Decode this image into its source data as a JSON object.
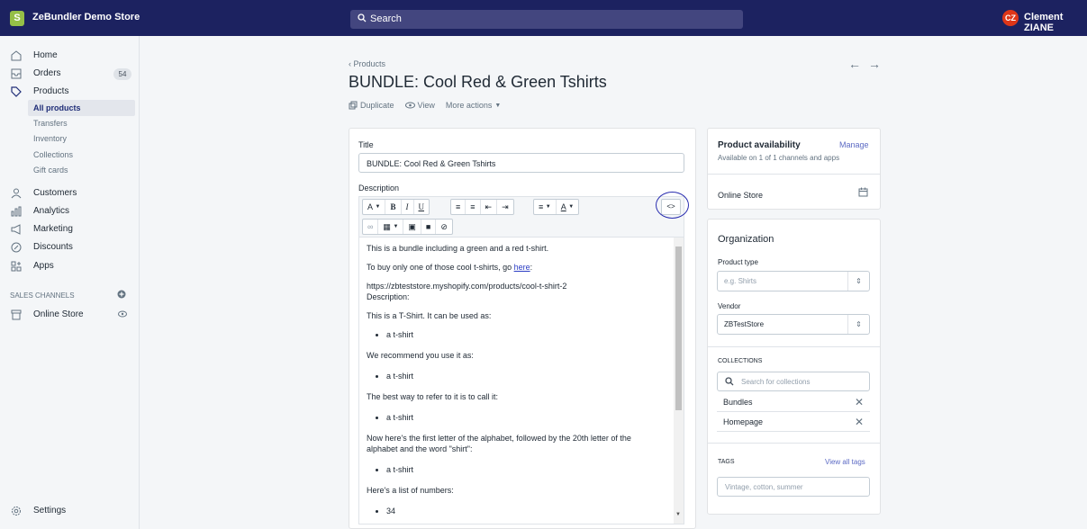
{
  "topbar": {
    "store_logo": "S",
    "store_name": "ZeBundler Demo Store",
    "search_placeholder": "Search",
    "avatar_initials": "CZ",
    "user_name": "Clement ZIANE"
  },
  "sidebar": {
    "items": [
      {
        "label": "Home"
      },
      {
        "label": "Orders",
        "badge": "54"
      },
      {
        "label": "Products"
      },
      {
        "label": "All products"
      },
      {
        "label": "Transfers"
      },
      {
        "label": "Inventory"
      },
      {
        "label": "Collections"
      },
      {
        "label": "Gift cards"
      },
      {
        "label": "Customers"
      },
      {
        "label": "Analytics"
      },
      {
        "label": "Marketing"
      },
      {
        "label": "Discounts"
      },
      {
        "label": "Apps"
      }
    ],
    "sales_channels_label": "SALES CHANNELS",
    "online_store": "Online Store",
    "settings": "Settings"
  },
  "page": {
    "back_label": "Products",
    "title": "BUNDLE: Cool Red & Green Tshirts",
    "actions": {
      "duplicate": "Duplicate",
      "view": "View",
      "more": "More actions"
    }
  },
  "form": {
    "title_label": "Title",
    "title_value": "BUNDLE: Cool Red & Green Tshirts",
    "description_label": "Description",
    "toolbar": {
      "format": "A",
      "bold": "B",
      "italic": "I",
      "underline": "U",
      "code": "<>"
    },
    "content": {
      "p1": "This is a bundle including a green and a red t-shirt.",
      "p2_pre": "To buy only one of those cool t-shirts, go ",
      "p2_link": "here",
      "p2_post": ":",
      "url": "https://zbteststore.myshopify.com/products/cool-t-shirt-2",
      "desc": "Description:",
      "p3": "This is a T-Shirt. It can be used as:",
      "li1": "a t-shirt",
      "p4": "We recommend you use it as:",
      "li2": "a t-shirt",
      "p5": "The best way to refer to it is to call it:",
      "li3": "a t-shirt",
      "p6": "Now here's the first letter of the alphabet, followed by the 20th letter of the alphabet and the word \"shirt\":",
      "li4": "a t-shirt",
      "p7": "Here's a list of numbers:",
      "li5": "34"
    }
  },
  "availability": {
    "title": "Product availability",
    "manage": "Manage",
    "subtitle": "Available on 1 of 1 channels and apps",
    "channel": "Online Store"
  },
  "organization": {
    "title": "Organization",
    "product_type_label": "Product type",
    "product_type_placeholder": "e.g. Shirts",
    "vendor_label": "Vendor",
    "vendor_value": "ZBTestStore",
    "collections_label": "COLLECTIONS",
    "collections_search_placeholder": "Search for collections",
    "collections": [
      "Bundles",
      "Homepage"
    ],
    "tags_label": "TAGS",
    "view_all_tags": "View all tags",
    "tags_placeholder": "Vintage, cotton, summer"
  },
  "colors": {
    "topbar": "#1c2260",
    "accent": "#5c6ac4",
    "annotation": "#2a2eb0"
  }
}
